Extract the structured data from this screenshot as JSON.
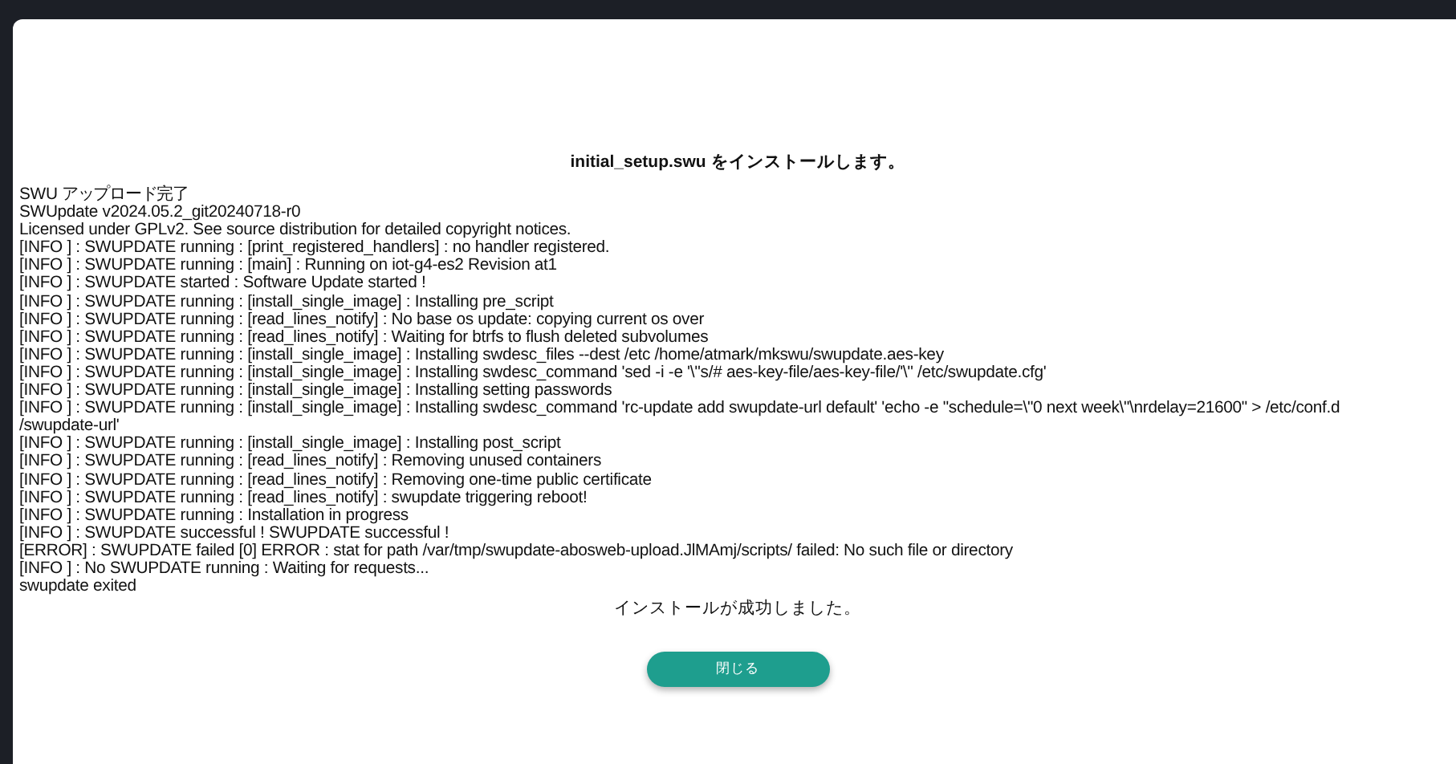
{
  "dialog": {
    "title": "initial_setup.swu をインストールします。",
    "log_lines": [
      "SWU アップロード完了",
      "SWUpdate v2024.05.2_git20240718-r0",
      "Licensed under GPLv2. See source distribution for detailed copyright notices.",
      "[INFO ] : SWUPDATE running : [print_registered_handlers] : no handler registered.",
      "[INFO ] : SWUPDATE running : [main] : Running on iot-g4-es2 Revision at1",
      "[INFO ] : SWUPDATE started : Software Update started !",
      "[INFO ] : SWUPDATE running : [install_single_image] : Installing pre_script",
      "[INFO ] : SWUPDATE running : [read_lines_notify] : No base os update: copying current os over",
      "[INFO ] : SWUPDATE running : [read_lines_notify] : Waiting for btrfs to flush deleted subvolumes",
      "[INFO ] : SWUPDATE running : [install_single_image] : Installing swdesc_files --dest /etc /home/atmark/mkswu/swupdate.aes-key",
      "[INFO ] : SWUPDATE running : [install_single_image] : Installing swdesc_command 'sed -i -e '\\''s/# aes-key-file/aes-key-file/'\\'' /etc/swupdate.cfg'",
      "[INFO ] : SWUPDATE running : [install_single_image] : Installing setting passwords",
      "[INFO ] : SWUPDATE running : [install_single_image] : Installing swdesc_command 'rc-update add swupdate-url default' 'echo -e \"schedule=\\\"0 next week\\\"\\nrdelay=21600\" > /etc/conf.d",
      "/swupdate-url'",
      "[INFO ] : SWUPDATE running : [install_single_image] : Installing post_script",
      "[INFO ] : SWUPDATE running : [read_lines_notify] : Removing unused containers",
      "[INFO ] : SWUPDATE running : [read_lines_notify] : Removing one-time public certificate",
      "[INFO ] : SWUPDATE running : [read_lines_notify] : swupdate triggering reboot!",
      "[INFO ] : SWUPDATE running : Installation in progress",
      "[INFO ] : SWUPDATE successful ! SWUPDATE successful !",
      "[ERROR] : SWUPDATE failed [0] ERROR : stat for path /var/tmp/swupdate-abosweb-upload.JlMAmj/scripts/ failed: No such file or directory",
      "[INFO ] : No SWUPDATE running : Waiting for requests...",
      "swupdate exited"
    ],
    "result": "インストールが成功しました。",
    "close_button": "閉じる"
  }
}
